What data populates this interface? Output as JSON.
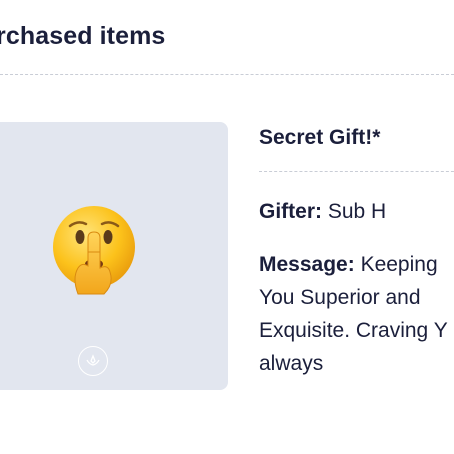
{
  "section": {
    "title": "rchased items"
  },
  "item": {
    "name": "Secret Gift!*",
    "emoji": "shushing-face",
    "gifter_label": "Gifter:",
    "gifter_value": "Sub H",
    "message_label": "Message:",
    "message_lines": [
      "Keeping",
      "You Superior and",
      "Exquisite. Craving Y",
      "always"
    ]
  },
  "colors": {
    "text": "#1b1f3b",
    "card_background": "#e2e6ef",
    "divider": "#c9cdd6"
  }
}
